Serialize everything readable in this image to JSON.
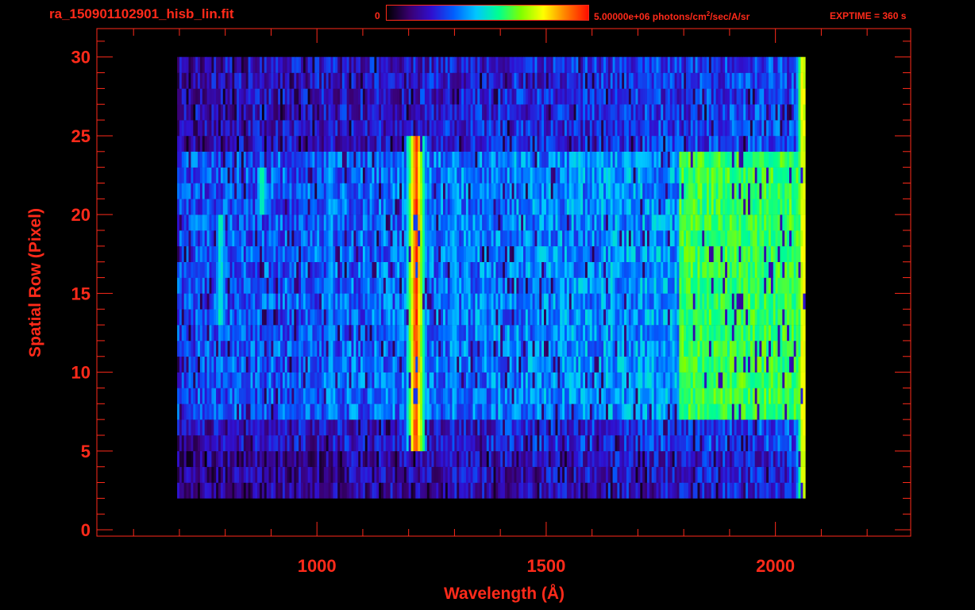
{
  "header": {
    "filename": "ra_150901102901_hisb_lin.fit",
    "colorbar_min": "0",
    "colorbar_max_prefix": "5.00000e+06 photons/cm",
    "colorbar_max_sup": "2",
    "colorbar_max_suffix": "/sec/A/sr",
    "exptime": "EXPTIME = 360 s"
  },
  "colors": {
    "axis": "#ff2a1a",
    "background": "#000000",
    "colormap": [
      "#000000",
      "#3a0070",
      "#3010d0",
      "#0060ff",
      "#00c8ff",
      "#00ff90",
      "#80ff00",
      "#ffff00",
      "#ff8000",
      "#ff1000"
    ]
  },
  "chart_data": {
    "type": "heatmap",
    "title": "ra_150901102901_hisb_lin.fit",
    "xlabel": "Wavelength (Å)",
    "ylabel": "Spatial Row (Pixel)",
    "xlim": [
      520,
      2295
    ],
    "ylim": [
      -0.4,
      31.8
    ],
    "x_ticks": [
      1000,
      1500,
      2000
    ],
    "x_minor_ticks": [
      600,
      700,
      800,
      900,
      1000,
      1100,
      1200,
      1300,
      1400,
      1500,
      1600,
      1700,
      1800,
      1900,
      2000,
      2100,
      2200
    ],
    "y_ticks": [
      0,
      5,
      10,
      15,
      20,
      25,
      30
    ],
    "y_minor_ticks": [
      1,
      2,
      3,
      4,
      6,
      7,
      8,
      9,
      11,
      12,
      13,
      14,
      16,
      17,
      18,
      19,
      21,
      22,
      23,
      24,
      26,
      27,
      28,
      29,
      31
    ],
    "colorbar_range": [
      0,
      5000000
    ],
    "colorbar_units": "photons/cm^2/sec/A/sr",
    "data_extent": {
      "x": [
        695,
        2065
      ],
      "rows": [
        2,
        30
      ]
    },
    "features": [
      {
        "name": "Lyman-alpha",
        "x": 1216,
        "rows": [
          5,
          25
        ],
        "level": 1.0
      },
      {
        "name": "arc",
        "x": 790,
        "rows": [
          13,
          20
        ],
        "level": 0.55
      },
      {
        "name": "arc-top",
        "x": 880,
        "rows": [
          20,
          23
        ],
        "level": 0.6
      },
      {
        "name": "line",
        "x": 1030,
        "rows": [
          7,
          24
        ],
        "level": 0.45
      },
      {
        "name": "line",
        "x": 1300,
        "rows": [
          7,
          24
        ],
        "level": 0.45
      },
      {
        "name": "line",
        "x": 1480,
        "rows": [
          7,
          23
        ],
        "level": 0.4
      },
      {
        "name": "band",
        "x": [
          1790,
          2060
        ],
        "rows": [
          7,
          24
        ],
        "level": 0.6
      },
      {
        "name": "edge",
        "x": 2060,
        "rows": [
          2,
          30
        ],
        "level": 0.85
      }
    ]
  },
  "labels": {
    "xlabel": "Wavelength (Å)",
    "ylabel": "Spatial Row (Pixel)"
  }
}
